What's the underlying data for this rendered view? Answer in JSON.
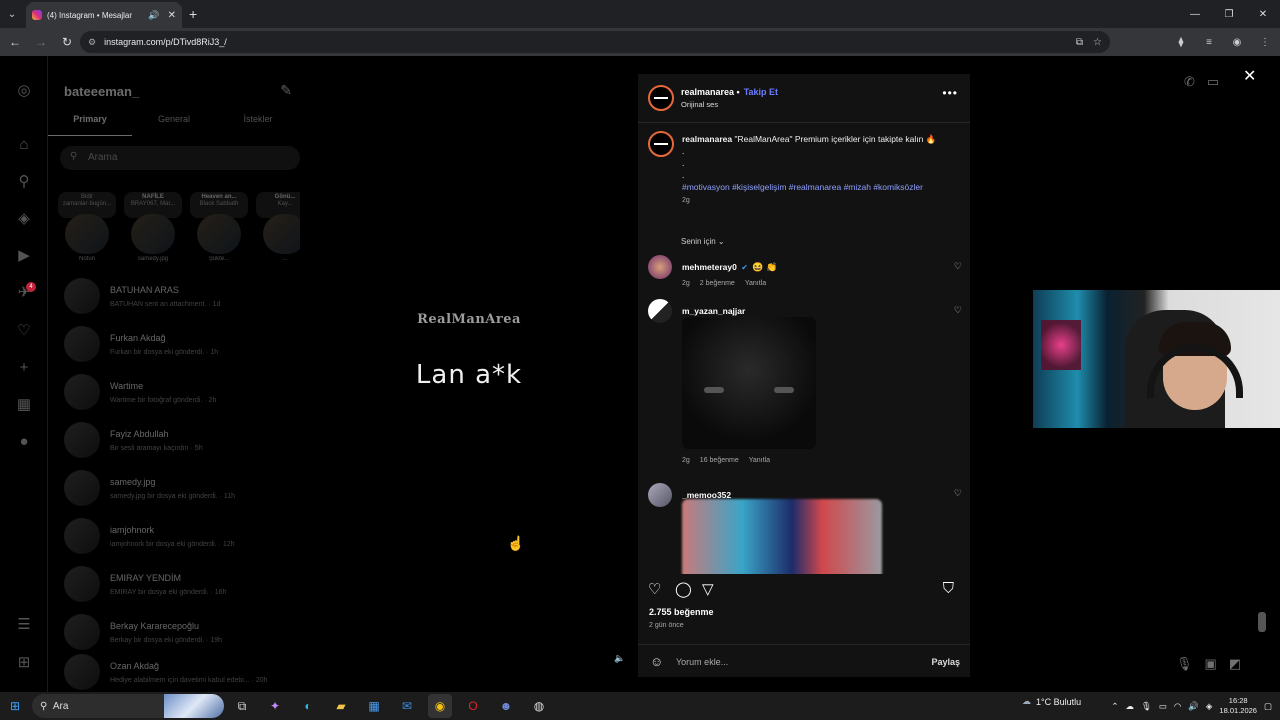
{
  "browser": {
    "tab_title": "(4) Instagram • Mesajlar",
    "url": "instagram.com/p/DTivd8RiJ3_/",
    "new_tab": "+",
    "controls": [
      "—",
      "❐",
      "✕"
    ]
  },
  "inbox": {
    "username": "bateeeman_",
    "tabs": [
      "Primary",
      "General",
      "İstekler"
    ],
    "search_placeholder": "Arama",
    "notes": [
      {
        "bubble": "Bidir zamanlar·bugün...",
        "name": "Notun"
      },
      {
        "bubble": "NAFİLE",
        "bubble2": "BRAY067, Mar...",
        "name": "samedy.jpg"
      },
      {
        "bubble": "Heaven an...",
        "bubble2": "Black Sabbath",
        "name": "Şükte..."
      },
      {
        "bubble": "Gönü...",
        "bubble2": "Kay...",
        "name": "..."
      }
    ],
    "threads": [
      {
        "name": "BATUHAN ARAS",
        "preview": "BATUHAN sent an attachment. · 1d"
      },
      {
        "name": "Furkan Akdağ",
        "preview": "Furkan bir dosya eki gönderdi. · 1h"
      },
      {
        "name": "Wartime",
        "preview": "Wartime bir fotoğraf gönderdi. · 2h"
      },
      {
        "name": "Fayiz Abdullah",
        "preview": "Bir sesli aramayı kaçırdın · 5h"
      },
      {
        "name": "samedy.jpg",
        "preview": "samedy.jpg bir dosya eki gönderdi. · 11h"
      },
      {
        "name": "iamjohnork",
        "preview": "iamjohnork bir dosya eki gönderdi. · 12h"
      },
      {
        "name": "EMIRAY YENDİM",
        "preview": "EMIRAY bir dosya eki gönderdi. · 16h"
      },
      {
        "name": "Berkay Kararecepoğlu",
        "preview": "Berkay bir dosya eki gönderdi. · 19h"
      },
      {
        "name": "Ozan Akdağ",
        "preview": "Hediye alabilmem için davetimi kabul edebi... · 20h"
      }
    ],
    "rail_badge": "4"
  },
  "reel": {
    "brand": "RealManArea",
    "caption": "Lan a*k"
  },
  "post": {
    "author": "realmanarea",
    "follow": "Takip Et",
    "audio": "Orijinal ses",
    "caption_author": "realmanarea",
    "caption_text": "\"RealManArea\" Premium içerikler için takipte kalın 🔥",
    "caption_dots": [
      ".",
      ".",
      "."
    ],
    "hashtags": "#motivasyon #kişiselgelişim #realmanarea #mizah #komiksözler",
    "caption_age": "2g",
    "sort_label": "Senin için",
    "comments": [
      {
        "user": "mehmeteray0",
        "text": "😆 👏",
        "age": "2g",
        "likes": "2 beğenme",
        "reply": "Yanıtla"
      },
      {
        "user": "m_yazan_najjar",
        "age": "2g",
        "likes": "16 beğenme",
        "reply": "Yanıtla"
      },
      {
        "user": "_memoo352"
      }
    ],
    "like_count": "2.755 beğenme",
    "posted": "2 gün önce",
    "comment_placeholder": "Yorum ekle...",
    "share": "Paylaş"
  },
  "taskbar": {
    "search": "Ara",
    "weather": "1°C  Bulutlu",
    "time": "16:28",
    "date": "18.01.2026"
  }
}
